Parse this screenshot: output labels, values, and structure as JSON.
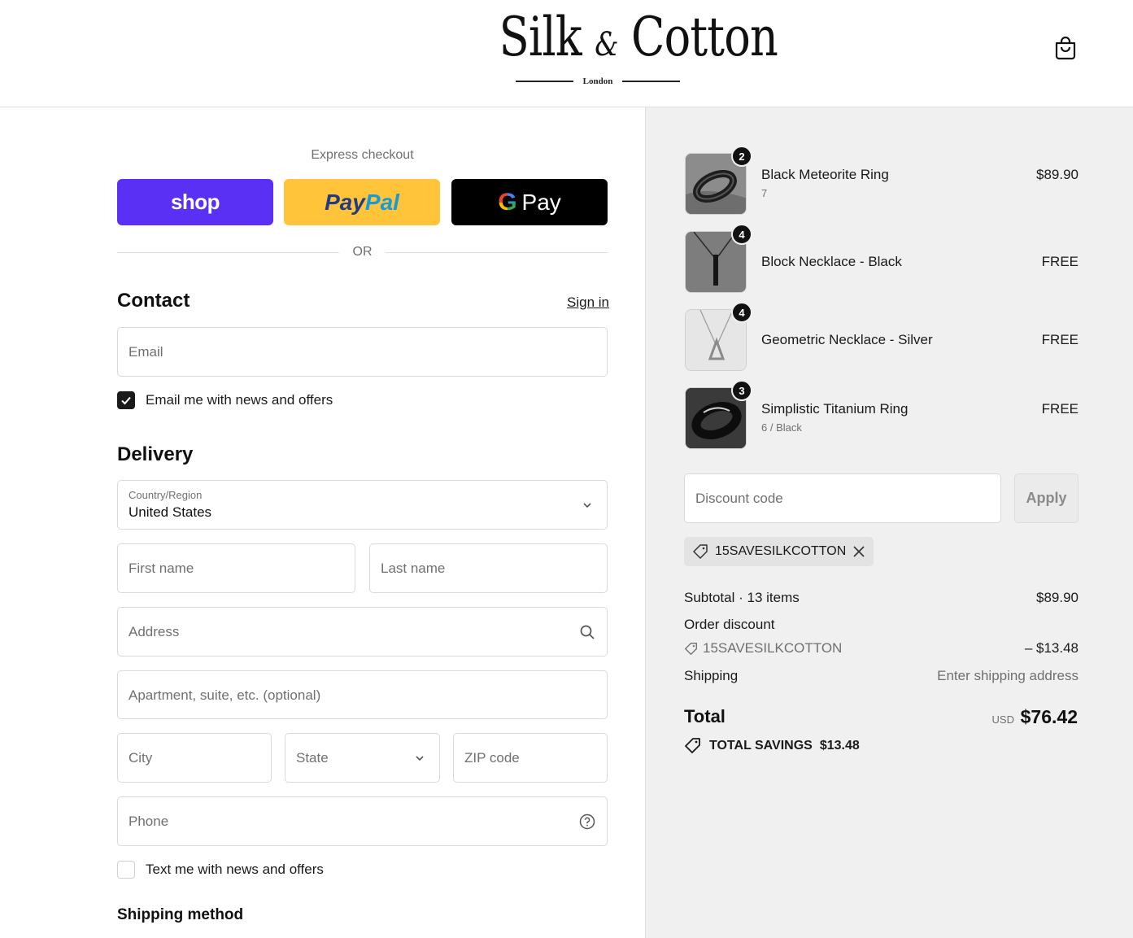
{
  "header": {
    "logo_main": "Silk",
    "logo_amp": "&",
    "logo_main2": "Cotton",
    "logo_sub": "London"
  },
  "express": {
    "title": "Express checkout",
    "shop_label": "shop",
    "paypal_part1": "Pay",
    "paypal_part2": "Pal",
    "gpay_g": "G",
    "gpay_label": "Pay",
    "or_label": "OR"
  },
  "contact": {
    "title": "Contact",
    "sign_in": "Sign in",
    "email_placeholder": "Email",
    "news_label": "Email me with news and offers",
    "news_checked": true
  },
  "delivery": {
    "title": "Delivery",
    "country_label": "Country/Region",
    "country_value": "United States",
    "first_name": "First name",
    "last_name": "Last name",
    "address": "Address",
    "apartment": "Apartment, suite, etc. (optional)",
    "city": "City",
    "state": "State",
    "zip": "ZIP code",
    "phone": "Phone",
    "text_label": "Text me with news and offers",
    "text_checked": false
  },
  "shipping_method": {
    "title": "Shipping method"
  },
  "cart": {
    "items": [
      {
        "name": "Black Meteorite Ring",
        "variant": "7",
        "qty": "2",
        "price": "$89.90"
      },
      {
        "name": "Block Necklace - Black",
        "variant": "",
        "qty": "4",
        "price": "FREE"
      },
      {
        "name": "Geometric Necklace - Silver",
        "variant": "",
        "qty": "4",
        "price": "FREE"
      },
      {
        "name": "Simplistic Titanium Ring",
        "variant": "6 / Black",
        "qty": "3",
        "price": "FREE"
      }
    ],
    "discount_placeholder": "Discount code",
    "apply_label": "Apply",
    "applied_code": "15SAVESILKCOTTON"
  },
  "summary": {
    "subtotal_label": "Subtotal · 13 items",
    "subtotal_value": "$89.90",
    "order_discount_label": "Order discount",
    "discount_code": "15SAVESILKCOTTON",
    "discount_value": "– $13.48",
    "shipping_label": "Shipping",
    "shipping_value": "Enter shipping address",
    "total_label": "Total",
    "currency": "USD",
    "total_value": "$76.42",
    "savings_label": "TOTAL SAVINGS",
    "savings_value": "$13.48"
  },
  "colors": {
    "shop": "#5a31f4",
    "paypal": "#ffc439",
    "gpay": "#000000",
    "summary_bg": "#f0f0f0"
  }
}
